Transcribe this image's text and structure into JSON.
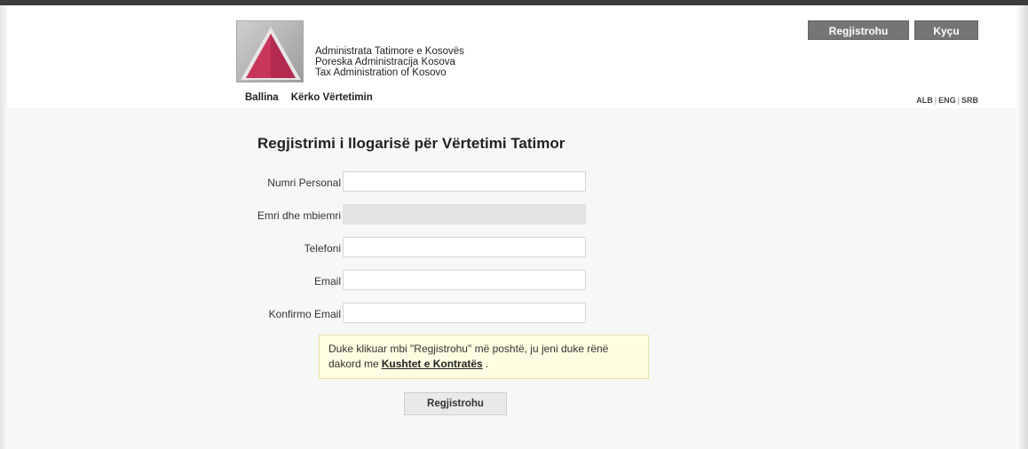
{
  "header": {
    "org_names": [
      "Administrata Tatimore e Kosovës",
      "Poreska Administracija Kosova",
      "Tax Administration of Kosovo"
    ],
    "register_label": "Regjistrohu",
    "login_label": "Kyçu",
    "nav": [
      "Ballina",
      "Kërko Vërtetimin"
    ],
    "languages": [
      "ALB",
      "ENG",
      "SRB"
    ]
  },
  "form": {
    "title": "Regjistrimi i llogarisë për Vërtetimi Tatimor",
    "fields": [
      {
        "label": "Numri Personal",
        "value": "",
        "disabled": false
      },
      {
        "label": "Emri dhe mbiemri",
        "value": "",
        "disabled": true
      },
      {
        "label": "Telefoni",
        "value": "",
        "disabled": false
      },
      {
        "label": "Email",
        "value": "",
        "disabled": false
      },
      {
        "label": "Konfirmo Email",
        "value": "",
        "disabled": false
      }
    ],
    "notice_text_1": "Duke klikuar mbi \"Regjistrohu\" më poshtë, ju jeni duke rënë dakord me",
    "notice_link": "Kushtet e Kontratës",
    "notice_text_2": ".",
    "submit_label": "Regjistrohu"
  },
  "colors": {
    "logo_triangle": "#c8365a",
    "top_buttons": "#757575",
    "content_bg": "#f7f7f7",
    "notice_bg": "#fdfde1"
  }
}
